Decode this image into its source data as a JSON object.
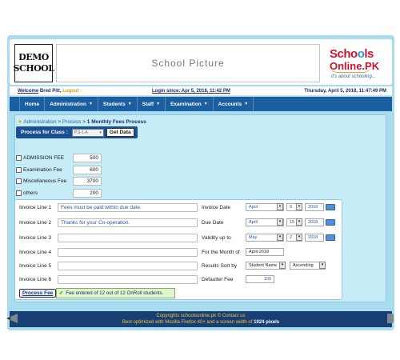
{
  "header": {
    "logo_line1": "DEMO",
    "logo_line2": "SCHOOL",
    "school_picture_label": "School Picture",
    "brand_name_part1": "Scho",
    "brand_name_o": "o",
    "brand_name_part2": "ls",
    "brand_name_line2": "Online.PK",
    "brand_tagline": "it's about schooling..."
  },
  "infobar": {
    "welcome_label": "Welcome",
    "user_name": "Bred Pitt",
    "logout_label": "Logout",
    "login_since": "Login since: Apr 5, 2018, 11:42 PM",
    "current_datetime": "Thursday, April 5, 2018, 11:47:49 PM"
  },
  "nav": {
    "items": [
      {
        "label": "Home",
        "has_dropdown": false
      },
      {
        "label": "Administration",
        "has_dropdown": true
      },
      {
        "label": "Students",
        "has_dropdown": true
      },
      {
        "label": "Staff",
        "has_dropdown": true
      },
      {
        "label": "Examination",
        "has_dropdown": true
      },
      {
        "label": "Accounts",
        "has_dropdown": true
      }
    ]
  },
  "breadcrumb": {
    "part1": "Administration",
    "sep": ">",
    "part2": "Process",
    "current": "1 Monthly Fees Process"
  },
  "process_for_class": {
    "label": "Process for Class :",
    "selected": "P.S-1-A",
    "get_data_label": "Get Data"
  },
  "fees": [
    {
      "name": "ADMISSION FEE",
      "amount": "500"
    },
    {
      "name": "Examination Fee",
      "amount": "600"
    },
    {
      "name": "Miscellaneous Fee",
      "amount": "3700"
    },
    {
      "name": "others",
      "amount": "200"
    }
  ],
  "invoice": {
    "lines": [
      {
        "label": "Invoice Line 1",
        "value": "Fees must be paid within due date."
      },
      {
        "label": "Invoice Line 2",
        "value": "Thanks for your Co-operation."
      },
      {
        "label": "Invoice Line 3",
        "value": ""
      },
      {
        "label": "Invoice Line 4",
        "value": ""
      },
      {
        "label": "Invoice Line 5",
        "value": ""
      },
      {
        "label": "Invoice Line 6",
        "value": ""
      }
    ],
    "invoice_date": {
      "label": "Invoice Date",
      "month": "April",
      "day": "5",
      "year": "2018"
    },
    "due_date": {
      "label": "Due Date",
      "month": "April",
      "day": "15",
      "year": "2018"
    },
    "validity": {
      "label": "Validity up to",
      "month": "May",
      "day": "2",
      "year": "2018"
    },
    "for_month": {
      "label": "For the Month of",
      "value": "April-2018"
    },
    "sort": {
      "label": "Results Sort by",
      "field": "Student Name",
      "order": "Ascending"
    },
    "defaulter": {
      "label": "Defaulter Fee",
      "value": "100"
    }
  },
  "process_button_label": "Process Fee",
  "status_message": "Fee entered of 12 out of 12 OnRoll students.",
  "footer": {
    "line1": "Copyrights schoolsonline.pk © Contact us",
    "line2_prefix": "Best optimized with Mozilla Firefox 40+ and a screen width of",
    "line2_bold": "1024 pixels"
  },
  "colors": {
    "nav_bg": "#1a5fa0",
    "frame_bg": "#a9dcef",
    "footer_bg": "#173f73",
    "brand_red": "#d0122f",
    "status_green_bg": "#dff5d0"
  }
}
